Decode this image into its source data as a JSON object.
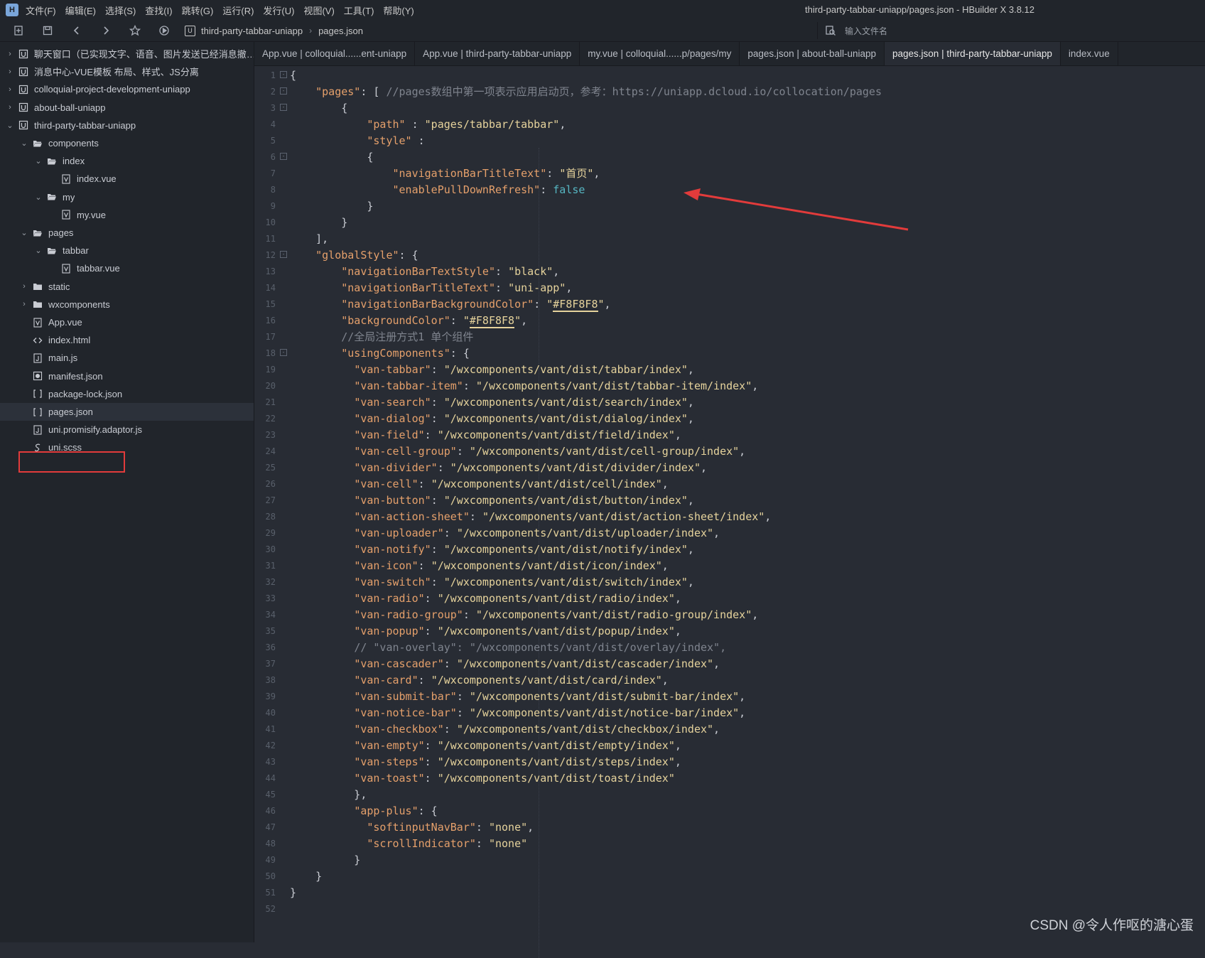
{
  "window": {
    "title": "third-party-tabbar-uniapp/pages.json - HBuilder X 3.8.12",
    "menus": [
      "文件(F)",
      "编辑(E)",
      "选择(S)",
      "查找(I)",
      "跳转(G)",
      "运行(R)",
      "发行(U)",
      "视图(V)",
      "工具(T)",
      "帮助(Y)"
    ]
  },
  "toolbar": {
    "breadcrumb_project": "third-party-tabbar-uniapp",
    "breadcrumb_file": "pages.json",
    "file_search_placeholder": "输入文件名"
  },
  "sidebar": {
    "rows": [
      {
        "label": "聊天窗口（已实现文字、语音、图片发送已经消息撤回...",
        "arrow": "›",
        "icon": "project"
      },
      {
        "label": "消息中心-VUE模板 布局、样式、JS分离",
        "arrow": "›",
        "icon": "project"
      },
      {
        "label": "colloquial-project-development-uniapp",
        "arrow": "›",
        "icon": "project"
      },
      {
        "label": "about-ball-uniapp",
        "arrow": "›",
        "icon": "project"
      },
      {
        "label": "third-party-tabbar-uniapp",
        "arrow": "⌄",
        "icon": "project"
      },
      {
        "label": "components",
        "arrow": "⌄",
        "icon": "folder-open"
      },
      {
        "label": "index",
        "arrow": "⌄",
        "icon": "folder-open"
      },
      {
        "label": "index.vue",
        "arrow": "",
        "icon": "vue-file"
      },
      {
        "label": "my",
        "arrow": "⌄",
        "icon": "folder-open"
      },
      {
        "label": "my.vue",
        "arrow": "",
        "icon": "vue-file"
      },
      {
        "label": "pages",
        "arrow": "⌄",
        "icon": "folder-open"
      },
      {
        "label": "tabbar",
        "arrow": "⌄",
        "icon": "folder-open"
      },
      {
        "label": "tabbar.vue",
        "arrow": "",
        "icon": "vue-file"
      },
      {
        "label": "static",
        "arrow": "›",
        "icon": "folder"
      },
      {
        "label": "wxcomponents",
        "arrow": "›",
        "icon": "folder"
      },
      {
        "label": "App.vue",
        "arrow": "",
        "icon": "vue-file"
      },
      {
        "label": "index.html",
        "arrow": "",
        "icon": "html-file"
      },
      {
        "label": "main.js",
        "arrow": "",
        "icon": "js-file"
      },
      {
        "label": "manifest.json",
        "arrow": "",
        "icon": "manifest-file"
      },
      {
        "label": "package-lock.json",
        "arrow": "",
        "icon": "json-file"
      },
      {
        "label": "pages.json",
        "arrow": "",
        "icon": "json-file"
      },
      {
        "label": "uni.promisify.adaptor.js",
        "arrow": "",
        "icon": "js-file"
      },
      {
        "label": "uni.scss",
        "arrow": "",
        "icon": "scss-file"
      }
    ]
  },
  "tabs": [
    "App.vue | colloquial......ent-uniapp",
    "App.vue | third-party-tabbar-uniapp",
    "my.vue | colloquial......p/pages/my",
    "pages.json | about-ball-uniapp",
    "pages.json | third-party-tabbar-uniapp",
    "index.vue"
  ],
  "editor": {
    "lines": [
      {
        "fold": true,
        "html": "{"
      },
      {
        "fold": true,
        "html": "    <span class=\"k\">\"pages\"</span>: [ <span class=\"c\">//pages数组中第一项表示应用启动页，参考：https://uniapp.dcloud.io/collocation/pages</span>"
      },
      {
        "fold": true,
        "html": "        {"
      },
      {
        "fold": false,
        "html": "            <span class=\"k\">\"path\"</span> : <span class=\"s\">\"pages/tabbar/tabbar\"</span>,"
      },
      {
        "fold": false,
        "html": "            <span class=\"k\">\"style\"</span> :"
      },
      {
        "fold": true,
        "html": "            {"
      },
      {
        "fold": false,
        "html": "                <span class=\"k\">\"navigationBarTitleText\"</span>: <span class=\"s\">\"首页\"</span>,"
      },
      {
        "fold": false,
        "html": "                <span class=\"k\">\"enablePullDownRefresh\"</span>: <span class=\"b\">false</span>"
      },
      {
        "fold": false,
        "html": "            }"
      },
      {
        "fold": false,
        "html": "        }"
      },
      {
        "fold": false,
        "html": "    ],"
      },
      {
        "fold": true,
        "html": "    <span class=\"k\">\"globalStyle\"</span>: {"
      },
      {
        "fold": false,
        "html": "        <span class=\"k\">\"navigationBarTextStyle\"</span>: <span class=\"s\">\"black\"</span>,"
      },
      {
        "fold": false,
        "html": "        <span class=\"k\">\"navigationBarTitleText\"</span>: <span class=\"s\">\"uni-app\"</span>,"
      },
      {
        "fold": false,
        "html": "        <span class=\"k\">\"navigationBarBackgroundColor\"</span>: <span class=\"s\">\"<span class=\"u\">#F8F8F8</span>\"</span>,"
      },
      {
        "fold": false,
        "html": "        <span class=\"k\">\"backgroundColor\"</span>: <span class=\"s\">\"<span class=\"u\">#F8F8F8</span>\"</span>,"
      },
      {
        "fold": false,
        "html": "        <span class=\"c\">//全局注册方式1 单个组件</span>"
      },
      {
        "fold": true,
        "html": "        <span class=\"k\">\"usingComponents\"</span>: {"
      },
      {
        "fold": false,
        "html": "          <span class=\"k\">\"van-tabbar\"</span>: <span class=\"s\">\"/wxcomponents/vant/dist/tabbar/index\"</span>,"
      },
      {
        "fold": false,
        "html": "          <span class=\"k\">\"van-tabbar-item\"</span>: <span class=\"s\">\"/wxcomponents/vant/dist/tabbar-item/index\"</span>,"
      },
      {
        "fold": false,
        "html": "          <span class=\"k\">\"van-search\"</span>: <span class=\"s\">\"/wxcomponents/vant/dist/search/index\"</span>,"
      },
      {
        "fold": false,
        "html": "          <span class=\"k\">\"van-dialog\"</span>: <span class=\"s\">\"/wxcomponents/vant/dist/dialog/index\"</span>,"
      },
      {
        "fold": false,
        "html": "          <span class=\"k\">\"van-field\"</span>: <span class=\"s\">\"/wxcomponents/vant/dist/field/index\"</span>,"
      },
      {
        "fold": false,
        "html": "          <span class=\"k\">\"van-cell-group\"</span>: <span class=\"s\">\"/wxcomponents/vant/dist/cell-group/index\"</span>,"
      },
      {
        "fold": false,
        "html": "          <span class=\"k\">\"van-divider\"</span>: <span class=\"s\">\"/wxcomponents/vant/dist/divider/index\"</span>,"
      },
      {
        "fold": false,
        "html": "          <span class=\"k\">\"van-cell\"</span>: <span class=\"s\">\"/wxcomponents/vant/dist/cell/index\"</span>,"
      },
      {
        "fold": false,
        "html": "          <span class=\"k\">\"van-button\"</span>: <span class=\"s\">\"/wxcomponents/vant/dist/button/index\"</span>,"
      },
      {
        "fold": false,
        "html": "          <span class=\"k\">\"van-action-sheet\"</span>: <span class=\"s\">\"/wxcomponents/vant/dist/action-sheet/index\"</span>,"
      },
      {
        "fold": false,
        "html": "          <span class=\"k\">\"van-uploader\"</span>: <span class=\"s\">\"/wxcomponents/vant/dist/uploader/index\"</span>,"
      },
      {
        "fold": false,
        "html": "          <span class=\"k\">\"van-notify\"</span>: <span class=\"s\">\"/wxcomponents/vant/dist/notify/index\"</span>,"
      },
      {
        "fold": false,
        "html": "          <span class=\"k\">\"van-icon\"</span>: <span class=\"s\">\"/wxcomponents/vant/dist/icon/index\"</span>,"
      },
      {
        "fold": false,
        "html": "          <span class=\"k\">\"van-switch\"</span>: <span class=\"s\">\"/wxcomponents/vant/dist/switch/index\"</span>,"
      },
      {
        "fold": false,
        "html": "          <span class=\"k\">\"van-radio\"</span>: <span class=\"s\">\"/wxcomponents/vant/dist/radio/index\"</span>,"
      },
      {
        "fold": false,
        "html": "          <span class=\"k\">\"van-radio-group\"</span>: <span class=\"s\">\"/wxcomponents/vant/dist/radio-group/index\"</span>,"
      },
      {
        "fold": false,
        "html": "          <span class=\"k\">\"van-popup\"</span>: <span class=\"s\">\"/wxcomponents/vant/dist/popup/index\"</span>,"
      },
      {
        "fold": false,
        "html": "          <span class=\"c\">// \"van-overlay\": \"/wxcomponents/vant/dist/overlay/index\",</span>"
      },
      {
        "fold": false,
        "html": "          <span class=\"k\">\"van-cascader\"</span>: <span class=\"s\">\"/wxcomponents/vant/dist/cascader/index\"</span>,"
      },
      {
        "fold": false,
        "html": "          <span class=\"k\">\"van-card\"</span>: <span class=\"s\">\"/wxcomponents/vant/dist/card/index\"</span>,"
      },
      {
        "fold": false,
        "html": "          <span class=\"k\">\"van-submit-bar\"</span>: <span class=\"s\">\"/wxcomponents/vant/dist/submit-bar/index\"</span>,"
      },
      {
        "fold": false,
        "html": "          <span class=\"k\">\"van-notice-bar\"</span>: <span class=\"s\">\"/wxcomponents/vant/dist/notice-bar/index\"</span>,"
      },
      {
        "fold": false,
        "html": "          <span class=\"k\">\"van-checkbox\"</span>: <span class=\"s\">\"/wxcomponents/vant/dist/checkbox/index\"</span>,"
      },
      {
        "fold": false,
        "html": "          <span class=\"k\">\"van-empty\"</span>: <span class=\"s\">\"/wxcomponents/vant/dist/empty/index\"</span>,"
      },
      {
        "fold": false,
        "html": "          <span class=\"k\">\"van-steps\"</span>: <span class=\"s\">\"/wxcomponents/vant/dist/steps/index\"</span>,"
      },
      {
        "fold": false,
        "html": "          <span class=\"k\">\"van-toast\"</span>: <span class=\"s\">\"/wxcomponents/vant/dist/toast/index\"</span>"
      },
      {
        "fold": false,
        "html": "          },"
      },
      {
        "fold": false,
        "html": "          <span class=\"k\">\"app-plus\"</span>: {"
      },
      {
        "fold": false,
        "html": "            <span class=\"k\">\"softinputNavBar\"</span>: <span class=\"s\">\"none\"</span>,"
      },
      {
        "fold": false,
        "html": "            <span class=\"k\">\"scrollIndicator\"</span>: <span class=\"s\">\"none\"</span>"
      },
      {
        "fold": false,
        "html": "          }"
      },
      {
        "fold": false,
        "html": "    }"
      },
      {
        "fold": false,
        "html": "}"
      },
      {
        "fold": false,
        "html": ""
      }
    ]
  },
  "watermark": "CSDN @令人作呕的溏心蛋"
}
